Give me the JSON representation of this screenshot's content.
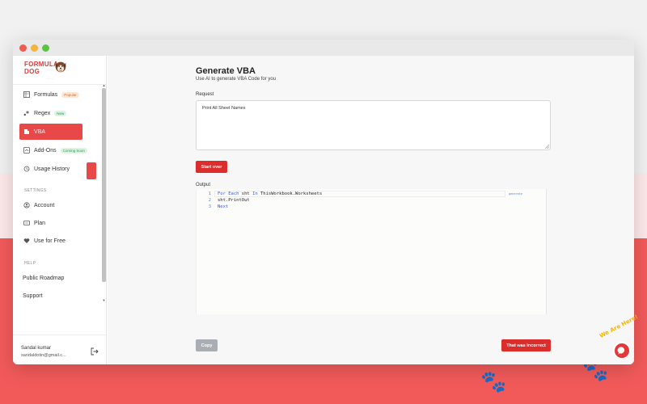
{
  "app": {
    "logo_line1": "FORMULA",
    "logo_line2": "DOG",
    "logo_tagline": "·········"
  },
  "sidebar": {
    "items": [
      {
        "label": "Formulas",
        "badge": "Popular",
        "icon": "formula-icon"
      },
      {
        "label": "Regex",
        "badge": "New",
        "icon": "regex-icon"
      },
      {
        "label": "VBA",
        "badge": "",
        "icon": "vba-icon",
        "active": true
      },
      {
        "label": "Add-Ons",
        "badge": "Coming Soon",
        "icon": "addons-icon"
      },
      {
        "label": "Usage History",
        "badge": "",
        "icon": "history-icon"
      }
    ],
    "settings_label": "SETTINGS",
    "settings_items": [
      {
        "label": "Account",
        "icon": "account-icon"
      },
      {
        "label": "Plan",
        "icon": "plan-icon"
      },
      {
        "label": "Use for Free",
        "icon": "heart-icon"
      }
    ],
    "help_label": "HELP",
    "help_items": [
      {
        "label": "Public Roadmap"
      },
      {
        "label": "Support"
      }
    ],
    "user": {
      "name": "Sandal kumar",
      "email": "sandaldotin@gmail.c..."
    }
  },
  "main": {
    "title": "Generate VBA",
    "subtitle": "Use AI to generate VBA Code for you",
    "request_label": "Request",
    "request_value": "Print All Sheet Names",
    "start_over_label": "Start over",
    "output_label": "Output",
    "code_lines": [
      {
        "num": "1",
        "kw1": "For Each",
        "mid": " sht ",
        "kw2": "In",
        "rest": " ThisWorkbook.Worksheets"
      },
      {
        "num": "2",
        "kw1": "",
        "mid": "sht.PrintOut",
        "kw2": "",
        "rest": ""
      },
      {
        "num": "3",
        "kw1": "Next",
        "mid": "",
        "kw2": "",
        "rest": ""
      }
    ],
    "side_mark": "generate",
    "copy_label": "Copy",
    "incorrect_label": "That was incorrect"
  },
  "widget": {
    "text": "We Are Here!"
  },
  "colors": {
    "accent": "#e84848",
    "button_red": "#dc2d2d",
    "button_grey": "#a9aeb4"
  }
}
